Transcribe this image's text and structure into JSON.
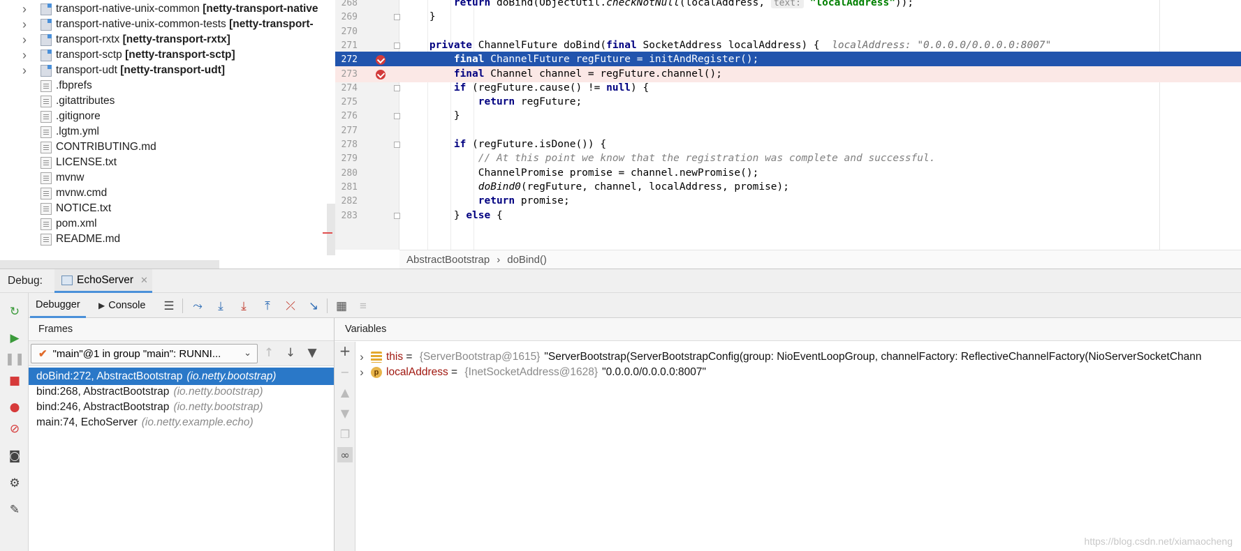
{
  "project_tree": {
    "items": [
      {
        "name": "transport-native-unix-common",
        "module": "[netty-transport-native",
        "type": "module",
        "expandable": true
      },
      {
        "name": "transport-native-unix-common-tests",
        "module": "[netty-transport-",
        "type": "module",
        "expandable": true
      },
      {
        "name": "transport-rxtx",
        "module": "[netty-transport-rxtx]",
        "type": "module",
        "expandable": true
      },
      {
        "name": "transport-sctp",
        "module": "[netty-transport-sctp]",
        "type": "module",
        "expandable": true
      },
      {
        "name": "transport-udt",
        "module": "[netty-transport-udt]",
        "type": "module",
        "expandable": true
      },
      {
        "name": ".fbprefs",
        "type": "file",
        "icon": "text-file-icon"
      },
      {
        "name": ".gitattributes",
        "type": "file",
        "icon": "text-file-icon"
      },
      {
        "name": ".gitignore",
        "type": "file",
        "icon": "gitignore-file-icon"
      },
      {
        "name": ".lgtm.yml",
        "type": "file",
        "icon": "yaml-file-icon"
      },
      {
        "name": "CONTRIBUTING.md",
        "type": "file",
        "icon": "markdown-file-icon"
      },
      {
        "name": "LICENSE.txt",
        "type": "file",
        "icon": "text-file-icon"
      },
      {
        "name": "mvnw",
        "type": "file",
        "icon": "shell-file-icon"
      },
      {
        "name": "mvnw.cmd",
        "type": "file",
        "icon": "text-file-icon"
      },
      {
        "name": "NOTICE.txt",
        "type": "file",
        "icon": "text-file-icon"
      },
      {
        "name": "pom.xml",
        "type": "file",
        "icon": "maven-file-icon"
      },
      {
        "name": "README.md",
        "type": "file",
        "icon": "markdown-file-icon"
      }
    ]
  },
  "editor": {
    "lines": [
      {
        "num": "268",
        "segments": [
          {
            "t": "        ",
            "c": ""
          },
          {
            "t": "return",
            "c": "kw"
          },
          {
            "t": " doBind(ObjectUtil.",
            "c": ""
          },
          {
            "t": "checkNotNull",
            "c": "ital"
          },
          {
            "t": "(localAddress, ",
            "c": ""
          },
          {
            "t": "text:",
            "c": "inlay"
          },
          {
            "t": " ",
            "c": ""
          },
          {
            "t": "\"localAddress\"",
            "c": "str"
          },
          {
            "t": "));",
            "c": ""
          }
        ]
      },
      {
        "num": "269",
        "segments": [
          {
            "t": "    }",
            "c": ""
          }
        ]
      },
      {
        "num": "270",
        "segments": [
          {
            "t": "",
            "c": ""
          }
        ]
      },
      {
        "num": "271",
        "segments": [
          {
            "t": "    ",
            "c": ""
          },
          {
            "t": "private",
            "c": "kw"
          },
          {
            "t": " ChannelFuture doBind(",
            "c": ""
          },
          {
            "t": "final",
            "c": "kw"
          },
          {
            "t": " SocketAddress localAddress) {  ",
            "c": ""
          },
          {
            "t": "localAddress: \"0.0.0.0/0.0.0.0:8007\"",
            "c": "hint"
          }
        ]
      },
      {
        "num": "272",
        "segments": [
          {
            "t": "        ",
            "c": ""
          },
          {
            "t": "final",
            "c": "kw"
          },
          {
            "t": " ChannelFuture regFuture = initAndRegister();",
            "c": ""
          }
        ]
      },
      {
        "num": "273",
        "segments": [
          {
            "t": "        ",
            "c": ""
          },
          {
            "t": "final",
            "c": "kw"
          },
          {
            "t": " Channel channel = regFuture.channel();",
            "c": ""
          }
        ]
      },
      {
        "num": "274",
        "segments": [
          {
            "t": "        ",
            "c": ""
          },
          {
            "t": "if",
            "c": "kw"
          },
          {
            "t": " (regFuture.cause() != ",
            "c": ""
          },
          {
            "t": "null",
            "c": "kw"
          },
          {
            "t": ") {",
            "c": ""
          }
        ]
      },
      {
        "num": "275",
        "segments": [
          {
            "t": "            ",
            "c": ""
          },
          {
            "t": "return",
            "c": "kw"
          },
          {
            "t": " regFuture;",
            "c": ""
          }
        ]
      },
      {
        "num": "276",
        "segments": [
          {
            "t": "        }",
            "c": ""
          }
        ]
      },
      {
        "num": "277",
        "segments": [
          {
            "t": "",
            "c": ""
          }
        ]
      },
      {
        "num": "278",
        "segments": [
          {
            "t": "        ",
            "c": ""
          },
          {
            "t": "if",
            "c": "kw"
          },
          {
            "t": " (regFuture.isDone()) {",
            "c": ""
          }
        ]
      },
      {
        "num": "279",
        "segments": [
          {
            "t": "            ",
            "c": ""
          },
          {
            "t": "// At this point we know that the registration was complete and successful.",
            "c": "cmt"
          }
        ]
      },
      {
        "num": "280",
        "segments": [
          {
            "t": "            ChannelPromise promise = channel.newPromise();",
            "c": ""
          }
        ]
      },
      {
        "num": "281",
        "segments": [
          {
            "t": "            ",
            "c": ""
          },
          {
            "t": "doBind0",
            "c": "ital"
          },
          {
            "t": "(regFuture, channel, localAddress, promise);",
            "c": ""
          }
        ]
      },
      {
        "num": "282",
        "segments": [
          {
            "t": "            ",
            "c": ""
          },
          {
            "t": "return",
            "c": "kw"
          },
          {
            "t": " promise;",
            "c": ""
          }
        ]
      },
      {
        "num": "283",
        "segments": [
          {
            "t": "        } ",
            "c": ""
          },
          {
            "t": "else",
            "c": "kw"
          },
          {
            "t": " {",
            "c": ""
          }
        ]
      }
    ],
    "current_line": "272",
    "breakpoint_lines": [
      "272",
      "273"
    ],
    "breadcrumb": {
      "class_name": "AbstractBootstrap",
      "separator": "›",
      "method": "doBind()"
    }
  },
  "debug": {
    "label": "Debug:",
    "session_tab": "EchoServer",
    "tabs": {
      "debugger": "Debugger",
      "console": "Console"
    },
    "frames_title": "Frames",
    "variables_title": "Variables",
    "thread_selector": "\"main\"@1 in group \"main\": RUNNI...",
    "frames": [
      {
        "method": "doBind:272, AbstractBootstrap",
        "package": "(io.netty.bootstrap)",
        "selected": true
      },
      {
        "method": "bind:268, AbstractBootstrap",
        "package": "(io.netty.bootstrap)",
        "selected": false
      },
      {
        "method": "bind:246, AbstractBootstrap",
        "package": "(io.netty.bootstrap)",
        "selected": false
      },
      {
        "method": "main:74, EchoServer",
        "package": "(io.netty.example.echo)",
        "selected": false
      }
    ],
    "variables": [
      {
        "name": "this",
        "eq": " = ",
        "type": "{ServerBootstrap@1615}",
        "value": "\"ServerBootstrap(ServerBootstrapConfig(group: NioEventLoopGroup, channelFactory: ReflectiveChannelFactory(NioServerSocketChann",
        "icon": "field-icon"
      },
      {
        "name": "localAddress",
        "eq": " = ",
        "type": "{InetSocketAddress@1628}",
        "value": "\"0.0.0.0/0.0.0.0:8007\"",
        "icon": "parameter-icon",
        "icon_letter": "p"
      }
    ]
  },
  "watermark": "https://blog.csdn.net/xiamaocheng",
  "colors": {
    "selection": "#2154ad",
    "frame_selection": "#2a78c8",
    "breakpoint": "#d33b3b",
    "keyword": "#000080",
    "string": "#008000"
  }
}
